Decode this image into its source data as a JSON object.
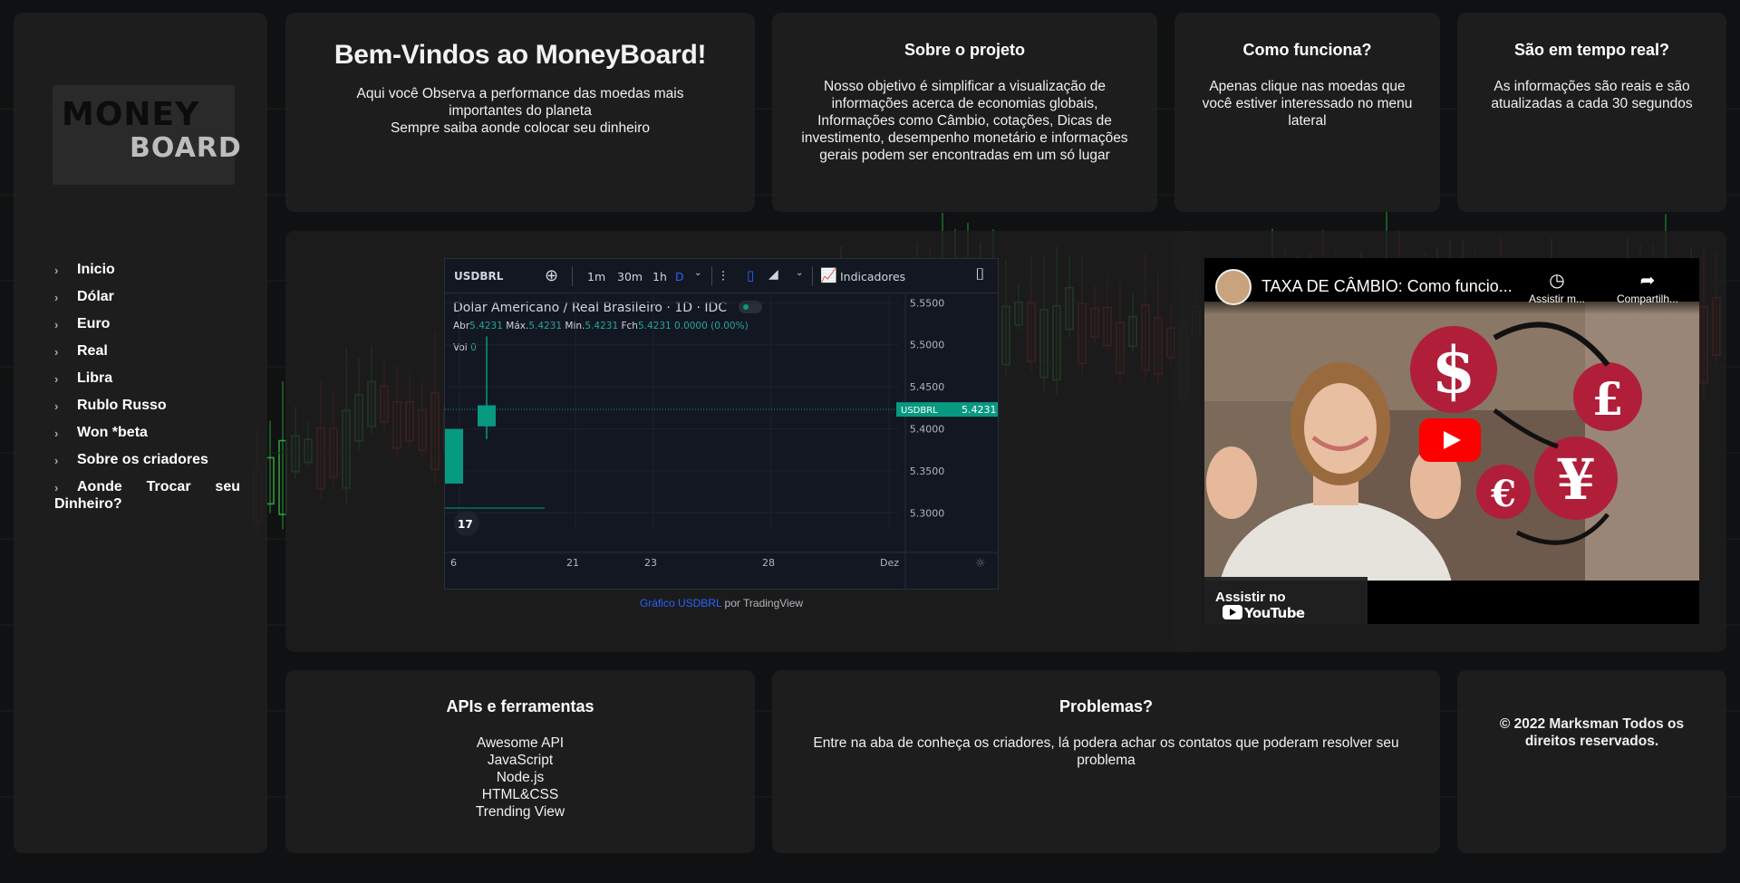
{
  "logo": {
    "line1": "MONEY",
    "line2": "BOARD"
  },
  "nav": {
    "items": [
      {
        "label": "Inicio"
      },
      {
        "label": "Dólar"
      },
      {
        "label": "Euro"
      },
      {
        "label": "Real"
      },
      {
        "label": "Libra"
      },
      {
        "label": "Rublo Russo"
      },
      {
        "label": "Won *beta"
      },
      {
        "label": "Sobre os criadores"
      },
      {
        "label": "Aonde Trocar seu Dinheiro?"
      }
    ]
  },
  "welcome": {
    "title": "Bem-Vindos ao MoneyBoard!",
    "line1": "Aqui você Observa a performance das moedas mais importantes do planeta",
    "line2": "Sempre saiba aonde colocar seu dinheiro"
  },
  "about": {
    "title": "Sobre o projeto",
    "text": "Nosso objetivo é simplificar a visualização de informações acerca de economias globais, Informações como Câmbio, cotações, Dicas de investimento, desempenho monetário e informações gerais podem ser encontradas em um só lugar"
  },
  "how": {
    "title": "Como funciona?",
    "text": "Apenas clique nas moedas que você estiver interessado no menu lateral"
  },
  "realtime": {
    "title": "São em tempo real?",
    "text": "As informações são reais e são atualizadas a cada 30 segundos"
  },
  "tradingview": {
    "symbol": "USDBRL",
    "intervals": [
      "1m",
      "30m",
      "1h",
      "D"
    ],
    "active_interval": "D",
    "indicators_label": "Indicadores",
    "legend": "Dolar Americano / Real Brasileiro · 1D · IDC",
    "ohlc": {
      "open_label": "Abr",
      "open": "5.4231",
      "high_label": "Máx.",
      "high": "5.4231",
      "low_label": "Mín.",
      "low": "5.4231",
      "close_label": "Fch",
      "close": "5.4231",
      "change": "0.0000 (0.00%)"
    },
    "volume_label": "Vol",
    "volume": "0",
    "price_label": "USDBRL",
    "price": "5.4231",
    "colors": {
      "up": "#089981",
      "bg": "#131722",
      "text": "#d1d4dc"
    },
    "caption_prefix": "Gráfico",
    "caption_link": "USDBRL",
    "caption_suffix": "por TradingView"
  },
  "chart_data": {
    "type": "candlestick",
    "title": "Dolar Americano / Real Brasileiro · 1D · IDC",
    "y_ticks": [
      "5.5500",
      "5.5000",
      "5.4500",
      "5.4000",
      "5.3500",
      "5.3000"
    ],
    "ylim": [
      5.28,
      5.56
    ],
    "x_ticks": [
      "6",
      "21",
      "23",
      "28",
      "Dez"
    ],
    "candles": [
      {
        "open": 5.335,
        "close": 5.4,
        "high": 5.4,
        "low": 5.335
      },
      {
        "open": 5.403,
        "close": 5.428,
        "high": 5.51,
        "low": 5.388
      }
    ],
    "last_price": 5.4231
  },
  "video": {
    "title": "TAXA DE CÂMBIO: Como funcio...",
    "watch_later": "Assistir m...",
    "share": "Compartilh...",
    "watch_on": "Assistir no",
    "youtube": "YouTube"
  },
  "apis": {
    "title": "APIs e ferramentas",
    "items": [
      "Awesome API",
      "JavaScript",
      "Node.js",
      "HTML&CSS",
      "Trending View"
    ]
  },
  "problems": {
    "title": "Problemas?",
    "text": "Entre na aba de conheça os criadores, lá podera achar os contatos que poderam resolver seu problema"
  },
  "copyright": {
    "text": "© 2022 Marksman Todos os direitos reservados."
  }
}
